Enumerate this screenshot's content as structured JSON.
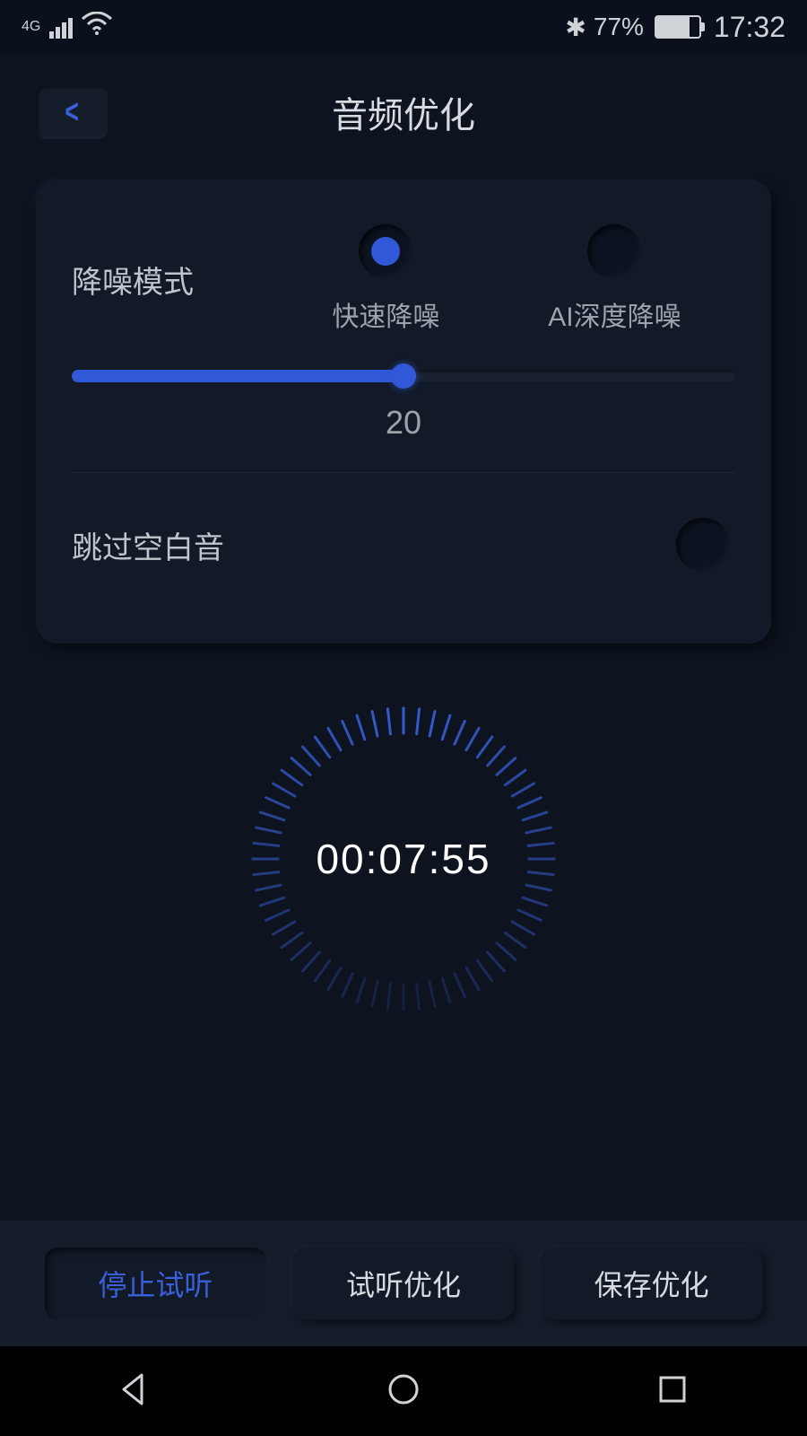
{
  "status": {
    "network": "4G",
    "bluetooth_icon": "✱",
    "battery_pct": "77%",
    "time": "17:32"
  },
  "header": {
    "title": "音频优化"
  },
  "noise": {
    "label": "降噪模式",
    "opt_fast": "快速降噪",
    "opt_ai": "AI深度降噪",
    "selected": "fast",
    "slider_value": "20",
    "slider_pct": 50
  },
  "skip": {
    "label": "跳过空白音",
    "enabled": false
  },
  "timer": {
    "display": "00:07:55"
  },
  "actions": {
    "stop": "停止试听",
    "preview": "试听优化",
    "save": "保存优化"
  }
}
